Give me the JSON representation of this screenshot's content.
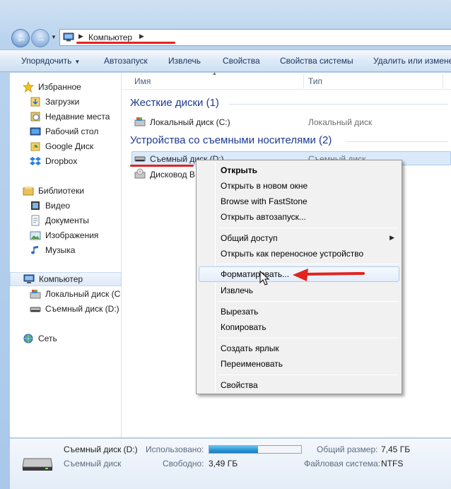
{
  "address": {
    "segment": "Компьютер"
  },
  "toolbar": {
    "items": [
      "Упорядочить",
      "Автозапуск",
      "Извлечь",
      "Свойства",
      "Свойства системы",
      "Удалить или измене"
    ]
  },
  "nav": {
    "favorites": "Избранное",
    "downloads": "Загрузки",
    "recent": "Недавние места",
    "desktop": "Рабочий стол",
    "gdrive": "Google Диск",
    "dropbox": "Dropbox",
    "libraries": "Библиотеки",
    "video": "Видео",
    "documents": "Документы",
    "images": "Изображения",
    "music": "Музыка",
    "computer": "Компьютер",
    "local_disk": "Локальный диск (C",
    "removable": "Съемный диск (D:)",
    "network": "Сеть"
  },
  "columns": {
    "name": "Имя",
    "type": "Тип"
  },
  "groups": {
    "hard": "Жесткие диски (1)",
    "removable": "Устройства со съемными носителями (2)"
  },
  "rows": {
    "local_name": "Локальный диск (C:)",
    "local_type": "Локальный диск",
    "removable_name": "Съемный диск (D:)",
    "removable_type": "Съемный диск",
    "bd_name": "Дисковод BD"
  },
  "context_menu": {
    "open": "Открыть",
    "open_new": "Открыть в новом окне",
    "faststone": "Browse with FastStone",
    "autoplay": "Открыть автозапуск...",
    "share": "Общий доступ",
    "open_portable": "Открыть как переносное устройство",
    "format": "Форматировать...",
    "eject": "Извлечь",
    "cut": "Вырезать",
    "copy": "Копировать",
    "shortcut": "Создать ярлык",
    "rename": "Переименовать",
    "properties": "Свойства"
  },
  "details": {
    "name": "Съемный диск (D:)",
    "type": "Съемный диск",
    "used_label": "Использовано:",
    "used_fraction": 0.53,
    "free_label": "Свободно:",
    "free_value": "3,49 ГБ",
    "total_label": "Общий размер:",
    "total_value": "7,45 ГБ",
    "fs_label": "Файловая система:",
    "fs_value": "NTFS"
  },
  "colors": {
    "annotation_red": "#e1241e",
    "group_blue": "#1e3a8f",
    "usage_bar": "#2793d3"
  }
}
